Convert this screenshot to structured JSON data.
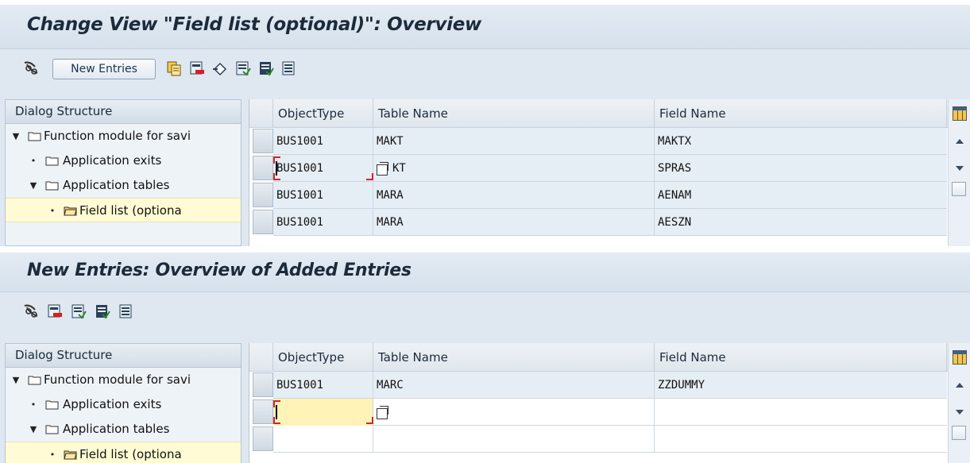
{
  "panel1": {
    "title": "Change View \"Field list (optional)\": Overview",
    "toolbar": {
      "new_entries_label": "New Entries"
    },
    "tree": {
      "header": "Dialog Structure",
      "items": [
        {
          "label": "Function module for savi",
          "marker": "▼"
        },
        {
          "label": "Application exits",
          "marker": "•"
        },
        {
          "label": "Application tables",
          "marker": "▼"
        },
        {
          "label": "Field list (optiona",
          "marker": "•"
        }
      ]
    },
    "table": {
      "columns": [
        "ObjectType",
        "Table Name",
        "Field Name"
      ],
      "rows": [
        [
          "BUS1001",
          "MAKT",
          "MAKTX"
        ],
        [
          "BUS1001",
          "KT",
          "SPRAS"
        ],
        [
          "BUS1001",
          "MARA",
          "AENAM"
        ],
        [
          "BUS1001",
          "MARA",
          "AESZN"
        ]
      ]
    }
  },
  "panel2": {
    "title": "New Entries: Overview of Added Entries",
    "tree": {
      "header": "Dialog Structure",
      "items": [
        {
          "label": "Function module for savi",
          "marker": "▼"
        },
        {
          "label": "Application exits",
          "marker": "•"
        },
        {
          "label": "Application tables",
          "marker": "▼"
        },
        {
          "label": "Field list (optiona",
          "marker": "•"
        }
      ]
    },
    "table": {
      "columns": [
        "ObjectType",
        "Table Name",
        "Field Name"
      ],
      "rows": [
        [
          "BUS1001",
          "MARC",
          "ZZDUMMY"
        ],
        [
          "",
          "",
          ""
        ],
        [
          "",
          "",
          ""
        ]
      ]
    }
  },
  "colors": {
    "background": "#dfe8f1",
    "selected_tree_item": "#fffbd4",
    "active_input": "#fff3b8",
    "focus_marker": "#d0262b"
  },
  "icons": [
    "glasses-icon",
    "copy-icon",
    "delete-icon",
    "undo-icon",
    "select-all-icon",
    "select-block-icon",
    "deselect-all-icon"
  ]
}
